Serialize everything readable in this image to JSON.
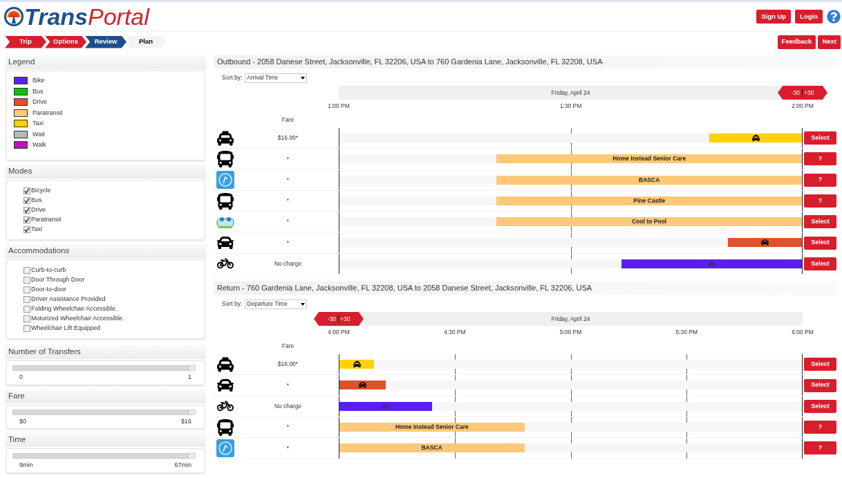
{
  "header": {
    "logo_prefix": "Trans",
    "logo_suffix": "Portal",
    "buttons": [
      {
        "label": "Sign Up"
      },
      {
        "label": "Login"
      }
    ]
  },
  "steps": [
    {
      "label": "Trip",
      "completed": true,
      "selected": false
    },
    {
      "label": "Options",
      "completed": true,
      "selected": false
    },
    {
      "label": "Review",
      "completed": false,
      "selected": true
    },
    {
      "label": "Plan",
      "completed": false,
      "selected": false
    }
  ],
  "actions": [
    {
      "label": "Feedback"
    },
    {
      "label": "Next"
    }
  ],
  "sidebar": {
    "legend": {
      "title": "Legend",
      "items": [
        {
          "label": "Bike",
          "color": "#5a1ef0"
        },
        {
          "label": "Bus",
          "color": "#10c010"
        },
        {
          "label": "Drive",
          "color": "#e0502a"
        },
        {
          "label": "Paratransit",
          "color": "#ffc87a"
        },
        {
          "label": "Taxi",
          "color": "#ffd200"
        },
        {
          "label": "Wait",
          "color": "#b8b8b8"
        },
        {
          "label": "Walk",
          "color": "#c010c0"
        }
      ]
    },
    "modes": {
      "title": "Modes",
      "options": [
        {
          "label": "Bicycle",
          "checked": true
        },
        {
          "label": "Bus",
          "checked": true
        },
        {
          "label": "Drive",
          "checked": true
        },
        {
          "label": "Paratransit",
          "checked": true
        },
        {
          "label": "Taxi",
          "checked": true
        }
      ]
    },
    "accommodations": {
      "title": "Accommodations",
      "options": [
        {
          "label": "Curb-to-curb",
          "checked": false
        },
        {
          "label": "Door Through Door",
          "checked": false
        },
        {
          "label": "Door-to-door",
          "checked": false
        },
        {
          "label": "Driver Assistance Provided",
          "checked": false
        },
        {
          "label": "Folding Wheelchair Accessible.",
          "checked": false
        },
        {
          "label": "Motorized Wheelchair Accessible.",
          "checked": false
        },
        {
          "label": "Wheelchair Lift Equipped",
          "checked": false
        }
      ]
    },
    "sliders": [
      {
        "title": "Number of Transfers",
        "min": "0",
        "max": "1",
        "level": 1
      },
      {
        "title": "Fare",
        "min": "$0",
        "max": "$16",
        "level": 1
      },
      {
        "title": "Time",
        "min": "9min",
        "max": "67min",
        "level": 1
      }
    ]
  },
  "trips": [
    {
      "kind": "outbound",
      "title": "Outbound - 2058 Danese Street, Jacksonville, FL 32206, USA to 760 Gardenia Lane, Jacksonville, FL 32208, USA",
      "sort_label": "Sort by:",
      "sort_value": "Arrival Time",
      "date": "Friday, April 24",
      "ticks": [
        "1:00 PM",
        "1:30 PM",
        "2:00 PM"
      ],
      "window": {
        "minus": "-30",
        "plus": "+30"
      },
      "fare_header": "Fare",
      "rows": [
        {
          "kind": "taxi",
          "fare": "$16.00*",
          "bar": {
            "level": 0.2,
            "color": "#ffd200"
          },
          "action": "Select"
        },
        {
          "kind": "bus",
          "fare": "*",
          "bar": {
            "level": 0.66,
            "color": "#ffc87a",
            "label": "Home Instead Senior Care"
          },
          "action": "?"
        },
        {
          "kind": "agency",
          "fare": "*",
          "bar": {
            "level": 0.66,
            "color": "#ffc87a",
            "label": "BASCA"
          },
          "action": "?"
        },
        {
          "kind": "bus",
          "fare": "*",
          "bar": {
            "level": 0.66,
            "color": "#ffc87a",
            "label": "Pine Castle"
          },
          "action": "?"
        },
        {
          "kind": "carpool",
          "fare": "*",
          "bar": {
            "level": 0.66,
            "color": "#ffc87a",
            "label": "Cool to Pool"
          },
          "action": "Select"
        },
        {
          "kind": "car",
          "fare": "*",
          "bar": {
            "level": 0.16,
            "color": "#e0502a"
          },
          "action": "Select"
        },
        {
          "kind": "bike",
          "fare": "No charge",
          "bar": {
            "level": 0.39,
            "color": "#5a1ef0"
          },
          "action": "Select"
        }
      ]
    },
    {
      "kind": "return",
      "title": "Return - 760 Gardenia Lane, Jacksonville, FL 32208, USA to 2058 Danese Street, Jacksonville, FL 32206, USA",
      "sort_label": "Sort by:",
      "sort_value": "Departure Time",
      "date": "Friday, April 24",
      "ticks": [
        "4:00 PM",
        "4:30 PM",
        "5:00 PM",
        "5:30 PM",
        "6:00 PM"
      ],
      "window": {
        "minus": "-30",
        "plus": "+30"
      },
      "fare_header": "Fare",
      "rows": [
        {
          "kind": "taxi",
          "fare": "$16.00*",
          "bar": {
            "level": 0.075,
            "color": "#ffd200"
          },
          "action": "Select"
        },
        {
          "kind": "car",
          "fare": "*",
          "bar": {
            "level": 0.1,
            "color": "#e0502a"
          },
          "action": "Select"
        },
        {
          "kind": "bike",
          "fare": "No charge",
          "bar": {
            "level": 0.2,
            "color": "#5a1ef0"
          },
          "action": "Select"
        },
        {
          "kind": "bus",
          "fare": "*",
          "bar": {
            "level": 0.4,
            "color": "#ffc87a",
            "label": "Home Instead Senior Care"
          },
          "action": "?"
        },
        {
          "kind": "agency",
          "fare": "*",
          "bar": {
            "level": 0.4,
            "color": "#ffc87a",
            "label": "BASCA"
          },
          "action": "?"
        }
      ]
    }
  ]
}
